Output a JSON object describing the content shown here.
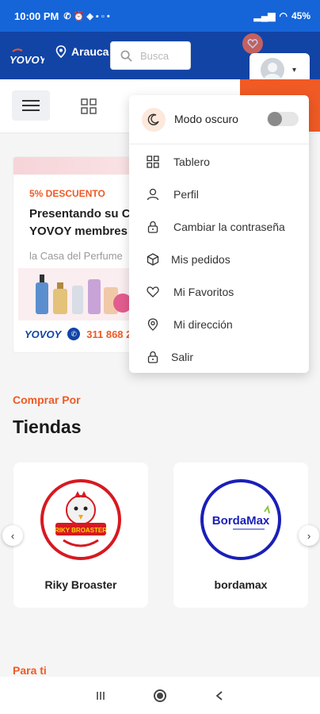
{
  "status_bar": {
    "time": "10:00 PM",
    "battery": "45%"
  },
  "header": {
    "logo_text": "YOVOY",
    "location": "Arauca",
    "search_placeholder": "Busca"
  },
  "promo": {
    "discount": "5% DESCUENTO",
    "title_line1": "Presentando su C",
    "title_line2": "YOVOY membres",
    "subtitle": "la Casa del Perfume",
    "brand": "YOVOY",
    "phone": "311 868 2"
  },
  "sections": {
    "shop_by": "Comprar Por",
    "stores_title": "Tiendas",
    "for_you": "Para ti"
  },
  "stores": [
    {
      "name": "Riky Broaster",
      "logo_text": "RIKY BROASTER"
    },
    {
      "name": "bordamax",
      "logo_text": "BordaMax"
    }
  ],
  "dropdown": {
    "dark_mode_label": "Modo oscuro",
    "dark_mode_on": false,
    "items": [
      {
        "label": "Tablero",
        "icon": "dashboard-icon"
      },
      {
        "label": "Perfil",
        "icon": "user-icon"
      },
      {
        "label": "Cambiar la contraseña",
        "icon": "lock-icon"
      },
      {
        "label": "Mis pedidos",
        "icon": "box-icon"
      },
      {
        "label": "Mi Favoritos",
        "icon": "heart-icon"
      },
      {
        "label": "Mi dirección",
        "icon": "location-icon"
      },
      {
        "label": "Salir",
        "icon": "lock-icon"
      }
    ]
  },
  "colors": {
    "brand_blue": "#1244a6",
    "status_blue": "#1565d8",
    "accent_orange": "#f05a24"
  }
}
